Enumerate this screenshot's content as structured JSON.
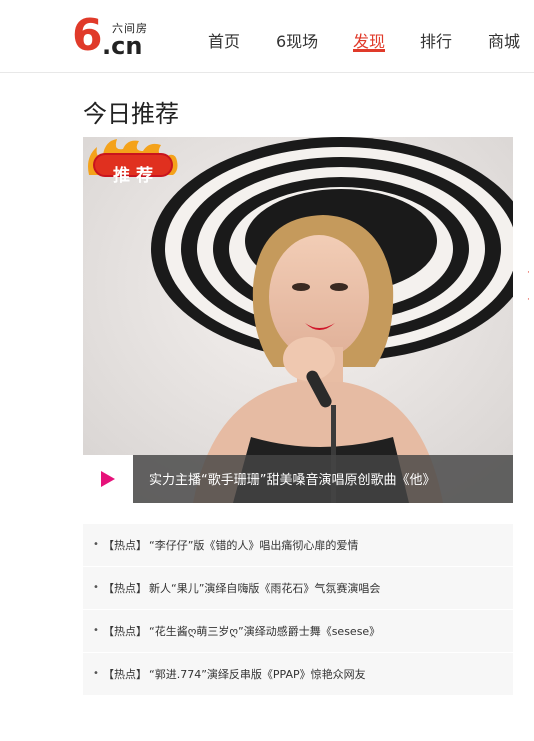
{
  "logo": {
    "main": "6",
    "domain": ".cn",
    "subtitle": "六间房"
  },
  "nav": {
    "items": [
      {
        "label": "首页",
        "active": false
      },
      {
        "label": "6现场",
        "active": false
      },
      {
        "label": "发现",
        "active": true
      },
      {
        "label": "排行",
        "active": false
      },
      {
        "label": "商城",
        "active": false
      }
    ]
  },
  "section": {
    "title": "今日推荐"
  },
  "feature": {
    "badge": "推荐",
    "caption": "实力主播“歌手珊珊”甜美嗓音演唱原创歌曲《他》",
    "play_icon": "play-icon"
  },
  "hot_list": [
    {
      "tag": "【热点】",
      "text": "“李仔仔”版《错的人》唱出痛彻心扉的爱情"
    },
    {
      "tag": "【热点】",
      "text": "新人“果儿”演绎自嗨版《雨花石》气氛赛演唱会"
    },
    {
      "tag": "【热点】",
      "text": "“花生酱ღ萌三岁ღ”演绎动感爵士舞《sesese》"
    },
    {
      "tag": "【热点】",
      "text": "“郭进.774”演绎反串版《PPAP》惊艳众网友"
    }
  ],
  "colors": {
    "brand": "#e03a2a",
    "accent_play": "#e6127a",
    "active_nav": "#e03a2a"
  }
}
